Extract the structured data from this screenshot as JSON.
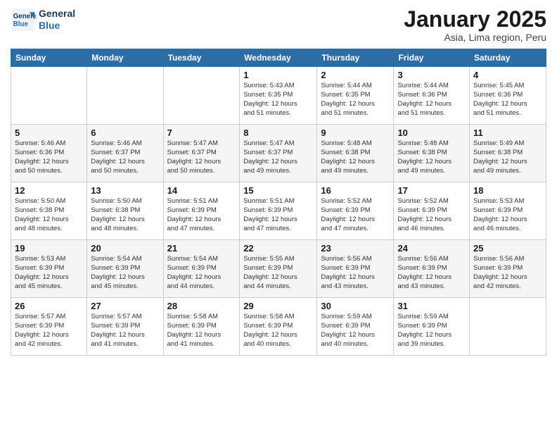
{
  "logo": {
    "name": "General Blue",
    "line1": "General",
    "line2": "Blue"
  },
  "title": "January 2025",
  "subtitle": "Asia, Lima region, Peru",
  "days_of_week": [
    "Sunday",
    "Monday",
    "Tuesday",
    "Wednesday",
    "Thursday",
    "Friday",
    "Saturday"
  ],
  "weeks": [
    [
      {
        "day": "",
        "info": ""
      },
      {
        "day": "",
        "info": ""
      },
      {
        "day": "",
        "info": ""
      },
      {
        "day": "1",
        "info": "Sunrise: 5:43 AM\nSunset: 6:35 PM\nDaylight: 12 hours\nand 51 minutes."
      },
      {
        "day": "2",
        "info": "Sunrise: 5:44 AM\nSunset: 6:35 PM\nDaylight: 12 hours\nand 51 minutes."
      },
      {
        "day": "3",
        "info": "Sunrise: 5:44 AM\nSunset: 6:36 PM\nDaylight: 12 hours\nand 51 minutes."
      },
      {
        "day": "4",
        "info": "Sunrise: 5:45 AM\nSunset: 6:36 PM\nDaylight: 12 hours\nand 51 minutes."
      }
    ],
    [
      {
        "day": "5",
        "info": "Sunrise: 5:46 AM\nSunset: 6:36 PM\nDaylight: 12 hours\nand 50 minutes."
      },
      {
        "day": "6",
        "info": "Sunrise: 5:46 AM\nSunset: 6:37 PM\nDaylight: 12 hours\nand 50 minutes."
      },
      {
        "day": "7",
        "info": "Sunrise: 5:47 AM\nSunset: 6:37 PM\nDaylight: 12 hours\nand 50 minutes."
      },
      {
        "day": "8",
        "info": "Sunrise: 5:47 AM\nSunset: 6:37 PM\nDaylight: 12 hours\nand 49 minutes."
      },
      {
        "day": "9",
        "info": "Sunrise: 5:48 AM\nSunset: 6:38 PM\nDaylight: 12 hours\nand 49 minutes."
      },
      {
        "day": "10",
        "info": "Sunrise: 5:48 AM\nSunset: 6:38 PM\nDaylight: 12 hours\nand 49 minutes."
      },
      {
        "day": "11",
        "info": "Sunrise: 5:49 AM\nSunset: 6:38 PM\nDaylight: 12 hours\nand 49 minutes."
      }
    ],
    [
      {
        "day": "12",
        "info": "Sunrise: 5:50 AM\nSunset: 6:38 PM\nDaylight: 12 hours\nand 48 minutes."
      },
      {
        "day": "13",
        "info": "Sunrise: 5:50 AM\nSunset: 6:38 PM\nDaylight: 12 hours\nand 48 minutes."
      },
      {
        "day": "14",
        "info": "Sunrise: 5:51 AM\nSunset: 6:39 PM\nDaylight: 12 hours\nand 47 minutes."
      },
      {
        "day": "15",
        "info": "Sunrise: 5:51 AM\nSunset: 6:39 PM\nDaylight: 12 hours\nand 47 minutes."
      },
      {
        "day": "16",
        "info": "Sunrise: 5:52 AM\nSunset: 6:39 PM\nDaylight: 12 hours\nand 47 minutes."
      },
      {
        "day": "17",
        "info": "Sunrise: 5:52 AM\nSunset: 6:39 PM\nDaylight: 12 hours\nand 46 minutes."
      },
      {
        "day": "18",
        "info": "Sunrise: 5:53 AM\nSunset: 6:39 PM\nDaylight: 12 hours\nand 46 minutes."
      }
    ],
    [
      {
        "day": "19",
        "info": "Sunrise: 5:53 AM\nSunset: 6:39 PM\nDaylight: 12 hours\nand 45 minutes."
      },
      {
        "day": "20",
        "info": "Sunrise: 5:54 AM\nSunset: 6:39 PM\nDaylight: 12 hours\nand 45 minutes."
      },
      {
        "day": "21",
        "info": "Sunrise: 5:54 AM\nSunset: 6:39 PM\nDaylight: 12 hours\nand 44 minutes."
      },
      {
        "day": "22",
        "info": "Sunrise: 5:55 AM\nSunset: 6:39 PM\nDaylight: 12 hours\nand 44 minutes."
      },
      {
        "day": "23",
        "info": "Sunrise: 5:56 AM\nSunset: 6:39 PM\nDaylight: 12 hours\nand 43 minutes."
      },
      {
        "day": "24",
        "info": "Sunrise: 5:56 AM\nSunset: 6:39 PM\nDaylight: 12 hours\nand 43 minutes."
      },
      {
        "day": "25",
        "info": "Sunrise: 5:56 AM\nSunset: 6:39 PM\nDaylight: 12 hours\nand 42 minutes."
      }
    ],
    [
      {
        "day": "26",
        "info": "Sunrise: 5:57 AM\nSunset: 6:39 PM\nDaylight: 12 hours\nand 42 minutes."
      },
      {
        "day": "27",
        "info": "Sunrise: 5:57 AM\nSunset: 6:39 PM\nDaylight: 12 hours\nand 41 minutes."
      },
      {
        "day": "28",
        "info": "Sunrise: 5:58 AM\nSunset: 6:39 PM\nDaylight: 12 hours\nand 41 minutes."
      },
      {
        "day": "29",
        "info": "Sunrise: 5:58 AM\nSunset: 6:39 PM\nDaylight: 12 hours\nand 40 minutes."
      },
      {
        "day": "30",
        "info": "Sunrise: 5:59 AM\nSunset: 6:39 PM\nDaylight: 12 hours\nand 40 minutes."
      },
      {
        "day": "31",
        "info": "Sunrise: 5:59 AM\nSunset: 6:39 PM\nDaylight: 12 hours\nand 39 minutes."
      },
      {
        "day": "",
        "info": ""
      }
    ]
  ]
}
